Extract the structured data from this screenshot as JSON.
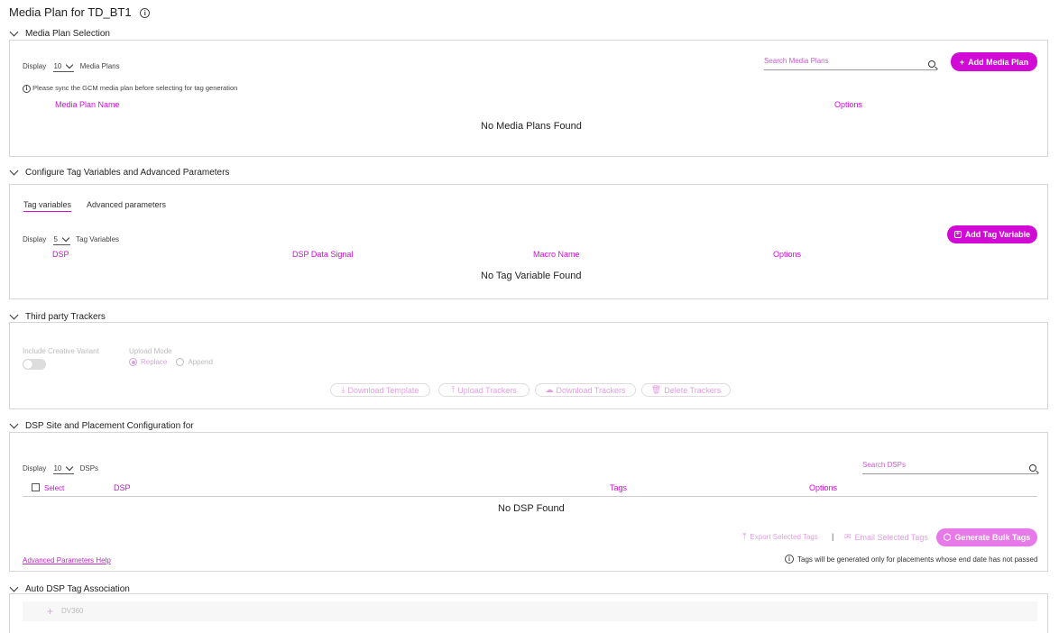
{
  "page": {
    "title": "Media Plan for TD_BT1"
  },
  "media_plan": {
    "section_title": "Media Plan Selection",
    "display_label": "Display",
    "display_value": "10",
    "display_suffix": "Media Plans",
    "search_placeholder": "Search Media Plans",
    "add_button": "Add Media Plan",
    "sync_note": "Please sync the GCM media plan before selecting for tag generation",
    "columns": [
      "Media Plan Name",
      "Options"
    ],
    "empty_text": "No Media Plans Found"
  },
  "tag_vars": {
    "section_title": "Configure Tag Variables and Advanced Parameters",
    "tabs": [
      "Tag variables",
      "Advanced parameters"
    ],
    "display_label": "Display",
    "display_value": "5",
    "display_suffix": "Tag Variables",
    "add_button": "Add Tag Variable",
    "columns": [
      "DSP",
      "DSP Data Signal",
      "Macro Name",
      "Options"
    ],
    "empty_text": "No Tag Variable Found"
  },
  "trackers": {
    "section_title": "Third party Trackers",
    "include_label": "Include Creative Variant",
    "upload_mode_label": "Upload Mode",
    "mode_replace": "Replace",
    "mode_append": "Append",
    "buttons": [
      "Download Template",
      "Upload Trackers",
      "Download Trackers",
      "Delete Trackers"
    ]
  },
  "dsp": {
    "section_title": "DSP Site and Placement Configuration for",
    "display_label": "Display",
    "display_value": "10",
    "display_suffix": "DSPs",
    "search_placeholder": "Search DSPs",
    "select_label": "Select",
    "columns": [
      "DSP",
      "Tags",
      "Options"
    ],
    "empty_text": "No DSP Found",
    "export_label": "Export Selected Tags",
    "email_label": "Email Selected Tags",
    "generate_button": "Generate Bulk Tags",
    "help_link": "Advanced Parameters Help",
    "end_date_note": "Tags will be generated only for placements whose end date has not passed"
  },
  "auto_dsp": {
    "section_title": "Auto DSP Tag Association",
    "item": "DV360"
  },
  "colors": {
    "accent": "#d10ad6",
    "accent_light": "#e879e8"
  }
}
